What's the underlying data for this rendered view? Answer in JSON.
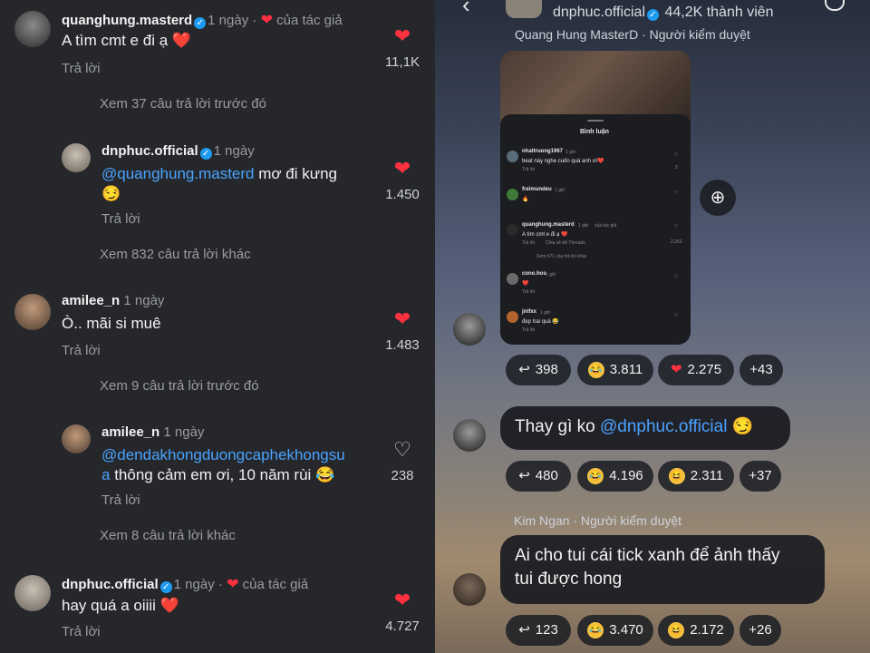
{
  "left": {
    "comments": [
      {
        "user": "quanghung.masterd",
        "time": "1 ngày",
        "author_badge": "của tác giả",
        "text": "A tìm cmt e đi ạ ❤️",
        "reply": "Trả lời",
        "likes": "11,1K"
      },
      {
        "see_prev": "Xem 37 câu trả lời trước đó"
      },
      {
        "user": "dnphuc.official",
        "time": "1 ngày",
        "mention": "@quanghung.masterd",
        "text": " mơ đi kưng",
        "emoji": "😏",
        "reply": "Trả lời",
        "likes": "1.450"
      },
      {
        "see_more": "Xem 832 câu trả lời khác"
      },
      {
        "user": "amilee_n",
        "time": "1 ngày",
        "text": "Ò.. mãi si muê",
        "reply": "Trả lời",
        "likes": "1.483"
      },
      {
        "see_prev": "Xem 9 câu trả lời trước đó"
      },
      {
        "user": "amilee_n",
        "time": "1 ngày",
        "mention_line1": "@dendakhongduongcaphekhongsu",
        "mention_line2": "a",
        "text": " thông cảm em ơi, 10 năm rùi 😂",
        "reply": "Trả lời",
        "likes": "238"
      },
      {
        "see_more": "Xem 8 câu trả lời khác"
      },
      {
        "user": "dnphuc.official",
        "time": "1 ngày",
        "author_badge": "của tác giả",
        "text": "hay quá a oiiii ❤️",
        "reply": "Trả lời",
        "likes": "4.727"
      }
    ]
  },
  "right": {
    "header": {
      "channel": "dnphuc.official",
      "members": "44,2K thành viên"
    },
    "sender_top": "Quang Hung MasterD · Người kiểm duyệt",
    "mini": {
      "title": "Bình luận",
      "c1_user": "nhattruong1967",
      "c1_time": "1 giờ",
      "c1_text": "beat này nghe cuốn quá anh ơi❤️",
      "c1_likes": "2",
      "c2_user": "freimundeu",
      "c2_time": "1 giờ",
      "c2_text": "🔥",
      "c3_user": "quanghung.masterd",
      "c3_time": "1 giờ",
      "c3_author": "của tác giả",
      "c3_text": "A tìm cmt e đi ạ ❤️",
      "c3_likes": "2.263",
      "c3_reply": "Trả lời",
      "c3_share": "Chia sẻ tới Threads",
      "c3_more": "Xem 471 câu trả lời khác",
      "c4_user": "cono.hos",
      "c4_time": "1 giờ",
      "c4_text": "❤️",
      "c5_user": "jntfxx",
      "c5_time": "1 giờ",
      "c5_text": "đẹp trai quá 😂",
      "reply": "Trả lời"
    },
    "msg1_reactions": {
      "replies": "398",
      "laugh": "3.811",
      "heart": "2.275",
      "more": "+43"
    },
    "msg2": {
      "text": "Thay gì ko ",
      "mention": "@dnphuc.official",
      "emoji": "😏"
    },
    "msg2_reactions": {
      "replies": "480",
      "laugh": "4.196",
      "smile": "2.311",
      "more": "+37"
    },
    "sender3": "Kim Ngan · Người kiểm duyệt",
    "msg3": {
      "line1": "Ai cho tui cái tick xanh để ảnh thấy",
      "line2": "tui được hong"
    },
    "msg3_reactions": {
      "replies": "123",
      "laugh": "3.470",
      "smile": "2.172",
      "more": "+26"
    },
    "colors": {
      "accent": "#4aa3ff",
      "heart": "#ff3040",
      "verified": "#1d9bf0"
    }
  }
}
